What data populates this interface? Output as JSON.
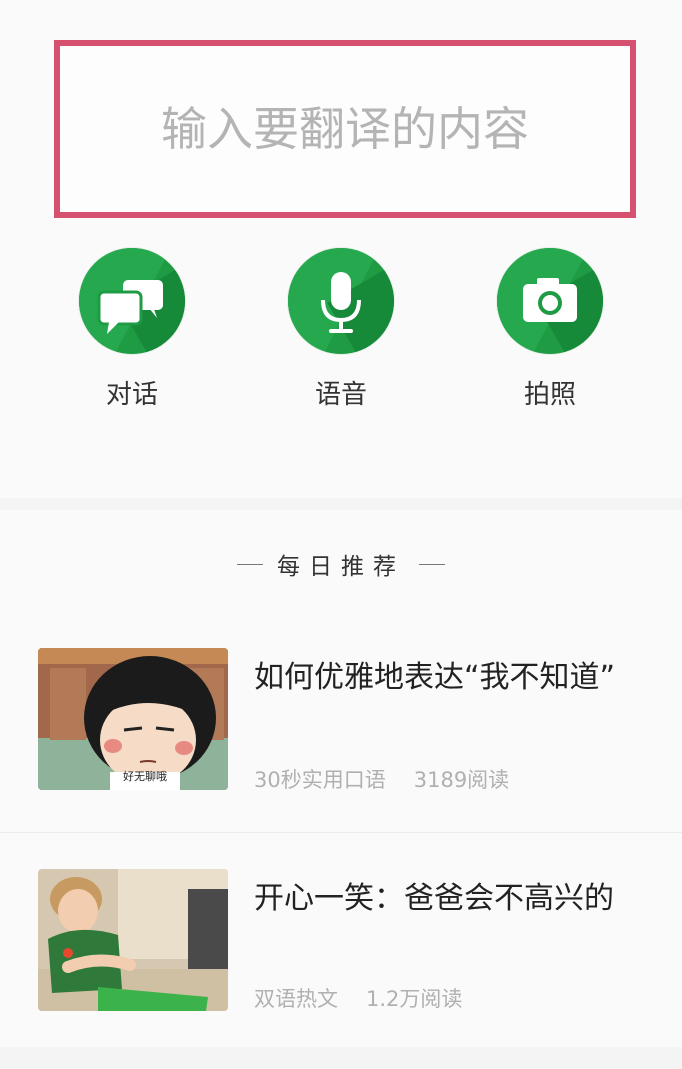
{
  "translate_input": {
    "placeholder": "输入要翻译的内容",
    "border_color": "#d6506f"
  },
  "actions": [
    {
      "label": "对话",
      "icon": "chat-bubbles-icon",
      "color": "#1f9b44"
    },
    {
      "label": "语音",
      "icon": "microphone-icon",
      "color": "#1f9b44"
    },
    {
      "label": "拍照",
      "icon": "camera-icon",
      "color": "#1f9b44"
    }
  ],
  "daily": {
    "heading": "每日推荐"
  },
  "articles": [
    {
      "title": "如何优雅地表达“我不知道”",
      "category": "30秒实用口语",
      "reads": "3189阅读",
      "thumb_caption": "好无聊哦"
    },
    {
      "title": "开心一笑：爸爸会不高兴的",
      "category": "双语热文",
      "reads": "1.2万阅读"
    }
  ]
}
